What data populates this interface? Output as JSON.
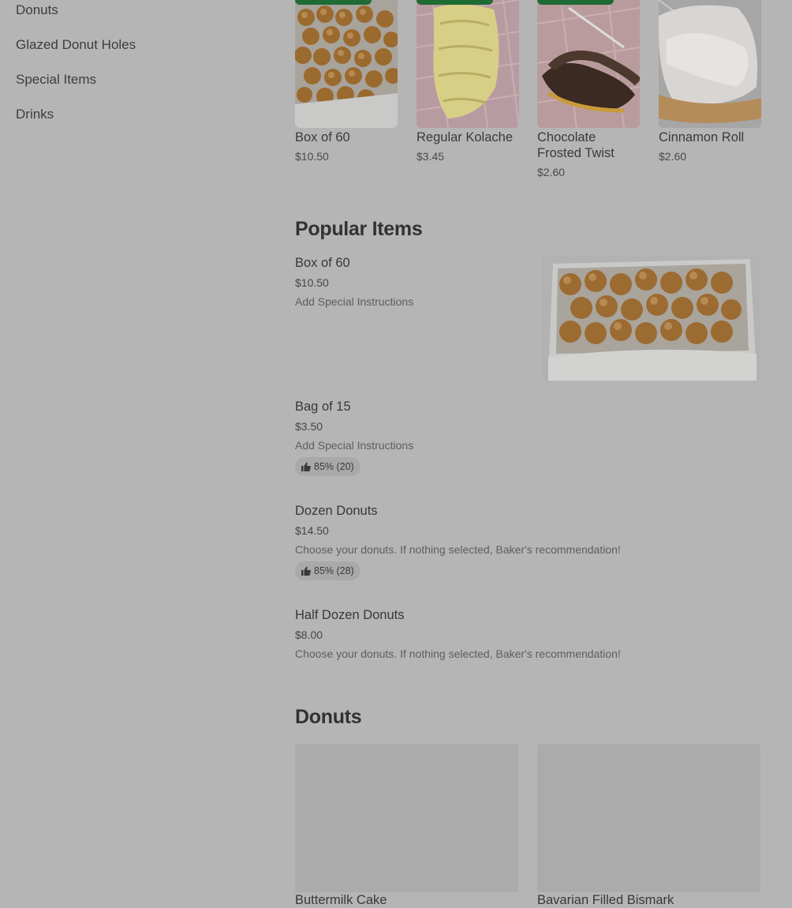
{
  "sidebar": {
    "items": [
      {
        "label": "Donuts"
      },
      {
        "label": "Glazed Donut Holes"
      },
      {
        "label": "Special Items"
      },
      {
        "label": "Drinks"
      }
    ]
  },
  "featured": {
    "items": [
      {
        "name": "Box of 60",
        "price": "$10.50"
      },
      {
        "name": "Regular Kolache",
        "price": "$3.45"
      },
      {
        "name": "Chocolate Frosted Twist",
        "price": "$2.60"
      },
      {
        "name": "Cinnamon Roll",
        "price": "$2.60"
      }
    ]
  },
  "popular": {
    "title": "Popular Items",
    "items": [
      {
        "name": "Box of 60",
        "price": "$10.50",
        "description": "Add Special Instructions"
      },
      {
        "name": "Bag of 15",
        "price": "$3.50",
        "description": "Add Special Instructions",
        "rating": "85% (20)"
      },
      {
        "name": "Dozen Donuts",
        "price": "$14.50",
        "description": "Choose your donuts. If nothing selected, Baker's recommendation!",
        "rating": "85% (28)"
      },
      {
        "name": "Half Dozen Donuts",
        "price": "$8.00",
        "description": "Choose your donuts. If nothing selected, Baker's recommendation!"
      }
    ]
  },
  "donuts_section": {
    "title": "Donuts",
    "items": [
      {
        "name": "Buttermilk Cake"
      },
      {
        "name": "Bavarian Filled Bismark"
      }
    ]
  },
  "icons": {
    "thumbs_up": "thumbs-up-icon"
  },
  "colors": {
    "overlay_background": "#b5b5b5",
    "badge_green": "#1f6b34"
  }
}
